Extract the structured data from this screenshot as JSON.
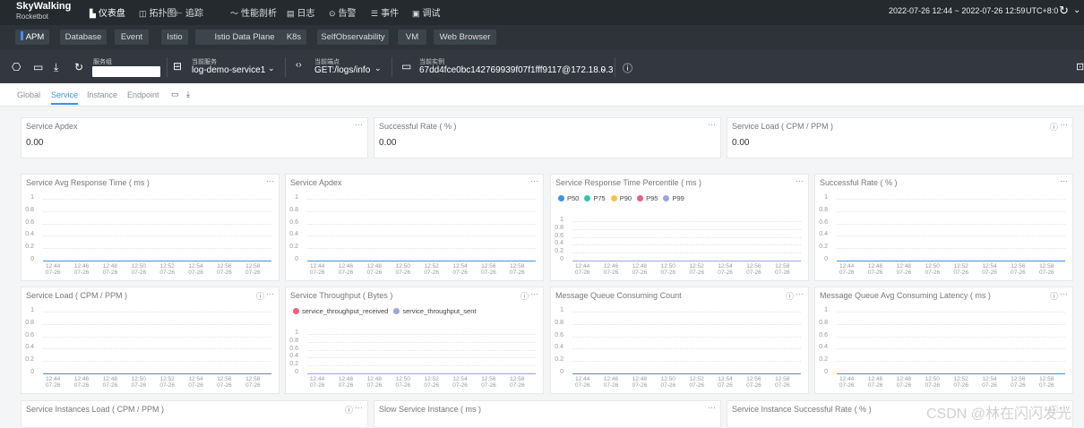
{
  "app": {
    "name": "SkyWalking",
    "sub": "Rocketbot"
  },
  "nav": [
    {
      "icon": "▙",
      "label": "仪表盘",
      "name": "nav-dashboard",
      "active": true
    },
    {
      "icon": "◫",
      "label": "拓扑图",
      "name": "nav-topology"
    },
    {
      "icon": "⊢",
      "label": "追踪",
      "name": "nav-trace"
    },
    {
      "icon": "〜",
      "label": "性能剖析",
      "name": "nav-profile"
    },
    {
      "icon": "▤",
      "label": "日志",
      "name": "nav-log"
    },
    {
      "icon": "⊙",
      "label": "告警",
      "name": "nav-alarm"
    },
    {
      "icon": "☰",
      "label": "事件",
      "name": "nav-event"
    },
    {
      "icon": "▣",
      "label": "调试",
      "name": "nav-debug"
    }
  ],
  "time_range": "2022-07-26 12:44 ~ 2022-07-26 12:59",
  "timezone": "UTC+8:0",
  "tabs": [
    "APM",
    "Database",
    "Event",
    "Istio",
    "Istio Data Plane",
    "K8s",
    "SelfObservability",
    "VM",
    "Web Browser"
  ],
  "selectors": {
    "group": {
      "label": "服务组",
      "value": ""
    },
    "service": {
      "label": "当前服务",
      "value": "log-demo-service1"
    },
    "endpoint": {
      "label": "当前端点",
      "value": "GET:/logs/info"
    },
    "instance": {
      "label": "当前实例",
      "value": "67dd4fce0bc142769939f07f1fff9117@172.18.0.3"
    }
  },
  "subtabs": [
    "Global",
    "Service",
    "Instance",
    "Endpoint"
  ],
  "row1": [
    {
      "title": "Service Apdex",
      "value": "0.00"
    },
    {
      "title": "Successful Rate ( % )",
      "value": "0.00"
    },
    {
      "title": "Service Load ( CPM / PPM )",
      "value": "0.00"
    }
  ],
  "chart_data": [
    {
      "type": "line",
      "title": "Service Avg Response Time ( ms )",
      "x": [
        "12:44",
        "12:46",
        "12:48",
        "12:50",
        "12:52",
        "12:54",
        "12:56",
        "12:58"
      ],
      "x_sub": "07-26",
      "ylim": [
        0,
        1
      ],
      "y_ticks": [
        "1",
        "0.8",
        "0.6",
        "0.4",
        "0.2",
        "0"
      ],
      "series": [
        {
          "values": [
            0,
            0,
            0,
            0,
            0,
            0,
            0,
            0
          ]
        }
      ]
    },
    {
      "type": "line",
      "title": "Service Apdex",
      "x": [
        "12:44",
        "12:46",
        "12:48",
        "12:50",
        "12:52",
        "12:54",
        "12:56",
        "12:58"
      ],
      "x_sub": "07-26",
      "ylim": [
        0,
        1
      ],
      "y_ticks": [
        "1",
        "0.8",
        "0.6",
        "0.4",
        "0.2",
        "0"
      ],
      "series": [
        {
          "values": [
            0,
            0,
            0,
            0,
            0,
            0,
            0,
            0
          ]
        }
      ]
    },
    {
      "type": "line",
      "title": "Service Response Time Percentile ( ms )",
      "x": [
        "12:44",
        "12:46",
        "12:48",
        "12:50",
        "12:52",
        "12:54",
        "12:56",
        "12:58"
      ],
      "x_sub": "07-26",
      "ylim": [
        0,
        1
      ],
      "y_ticks": [
        "1",
        "0.8",
        "0.6",
        "0.4",
        "0.2",
        "0"
      ],
      "series": [
        {
          "name": "P50",
          "color": "#3d92e4",
          "values": [
            0,
            0,
            0,
            0,
            0,
            0,
            0,
            0
          ]
        },
        {
          "name": "P75",
          "color": "#2ec4b0",
          "values": [
            0,
            0,
            0,
            0,
            0,
            0,
            0,
            0
          ]
        },
        {
          "name": "P90",
          "color": "#f7c744",
          "values": [
            0,
            0,
            0,
            0,
            0,
            0,
            0,
            0
          ]
        },
        {
          "name": "P95",
          "color": "#ee5f7b",
          "values": [
            0,
            0,
            0,
            0,
            0,
            0,
            0,
            0
          ]
        },
        {
          "name": "P99",
          "color": "#9aa5e0",
          "values": [
            0,
            0,
            0,
            0,
            0,
            0,
            0,
            0
          ]
        }
      ]
    },
    {
      "type": "line",
      "title": "Successful Rate ( % )",
      "x": [
        "12:44",
        "12:46",
        "12:48",
        "12:50",
        "12:52",
        "12:54",
        "12:56",
        "12:58"
      ],
      "x_sub": "07-26",
      "ylim": [
        0,
        1
      ],
      "y_ticks": [
        "1",
        "0.8",
        "0.6",
        "0.4",
        "0.2",
        "0"
      ],
      "series": [
        {
          "values": [
            0,
            0,
            0,
            0,
            0,
            0,
            0,
            0
          ]
        }
      ]
    },
    {
      "type": "line",
      "title": "Service Load ( CPM / PPM )",
      "x": [
        "12:44",
        "12:46",
        "12:48",
        "12:50",
        "12:52",
        "12:54",
        "12:56",
        "12:58"
      ],
      "x_sub": "07-26",
      "ylim": [
        0,
        1
      ],
      "y_ticks": [
        "1",
        "0.8",
        "0.6",
        "0.4",
        "0.2",
        "0"
      ],
      "series": [
        {
          "values": [
            0,
            0,
            0,
            0,
            0,
            0,
            0,
            0
          ]
        }
      ]
    },
    {
      "type": "line",
      "title": "Service Throughput ( Bytes )",
      "x": [
        "12:44",
        "12:46",
        "12:48",
        "12:50",
        "12:52",
        "12:54",
        "12:56",
        "12:58"
      ],
      "x_sub": "07-26",
      "ylim": [
        0,
        1
      ],
      "y_ticks": [
        "1",
        "0.8",
        "0.6",
        "0.4",
        "0.2",
        "0"
      ],
      "series": [
        {
          "name": "service_throughput_received",
          "color": "#ee5f7b",
          "values": [
            0,
            0,
            0,
            0,
            0,
            0,
            0,
            0
          ]
        },
        {
          "name": "service_throughput_sent",
          "color": "#9aa5e0",
          "values": [
            0,
            0,
            0,
            0,
            0,
            0,
            0,
            0
          ]
        }
      ]
    },
    {
      "type": "line",
      "title": "Message Queue Consuming Count",
      "x": [
        "12:44",
        "12:46",
        "12:48",
        "12:50",
        "12:52",
        "12:54",
        "12:56",
        "12:58"
      ],
      "x_sub": "07-26",
      "ylim": [
        0,
        1
      ],
      "y_ticks": [
        "1",
        "0.8",
        "0.6",
        "0.4",
        "0.2",
        "0"
      ],
      "series": [
        {
          "values": [
            0,
            0,
            0,
            0,
            0,
            0,
            0,
            0
          ]
        }
      ]
    },
    {
      "type": "line",
      "title": "Message Queue Avg Consuming Latency ( ms )",
      "x": [
        "12:44",
        "12:46",
        "12:48",
        "12:50",
        "12:52",
        "12:54",
        "12:56",
        "12:58"
      ],
      "x_sub": "07-26",
      "ylim": [
        0,
        1
      ],
      "y_ticks": [
        "1",
        "0.8",
        "0.6",
        "0.4",
        "0.2",
        "0"
      ],
      "series": [
        {
          "values": [
            0,
            0,
            0,
            0,
            0,
            0,
            0,
            0
          ]
        }
      ]
    }
  ],
  "row4": [
    {
      "title": "Service Instances Load ( CPM / PPM )"
    },
    {
      "title": "Slow Service Instance ( ms )"
    },
    {
      "title": "Service Instance Successful Rate ( % )"
    }
  ],
  "watermark": "CSDN @林在闪闪发光"
}
